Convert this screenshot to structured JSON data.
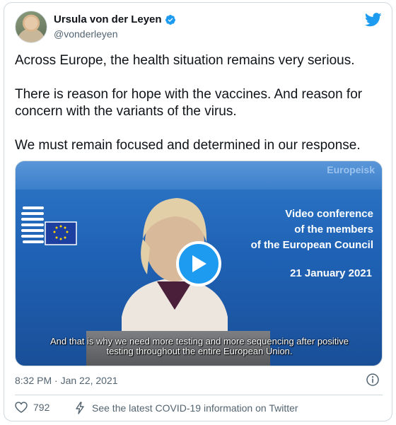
{
  "author": {
    "name": "Ursula von der Leyen",
    "handle": "@vonderleyen",
    "verified": true
  },
  "tweet": {
    "text": "Across Europe, the health situation remains very serious.\n\nThere is reason for hope with the vaccines. And reason for concern with the variants of the virus.\n\nWe must remain focused and determined in our response."
  },
  "video": {
    "watermark": "Europeisk",
    "conference_lines": [
      "Video conference",
      "of the members",
      "of the European Council"
    ],
    "date": "21 January  2021",
    "subtitle": "And that is why we need more testing and more sequencing after positive testing throughout the entire European Union."
  },
  "footer": {
    "timestamp": "8:32 PM · Jan 22, 2021",
    "likes": "792",
    "covid_link": "See the latest COVID-19 information on Twitter"
  },
  "colors": {
    "accent": "#1d9bf0",
    "text_primary": "#0f1419",
    "text_secondary": "#536471"
  }
}
